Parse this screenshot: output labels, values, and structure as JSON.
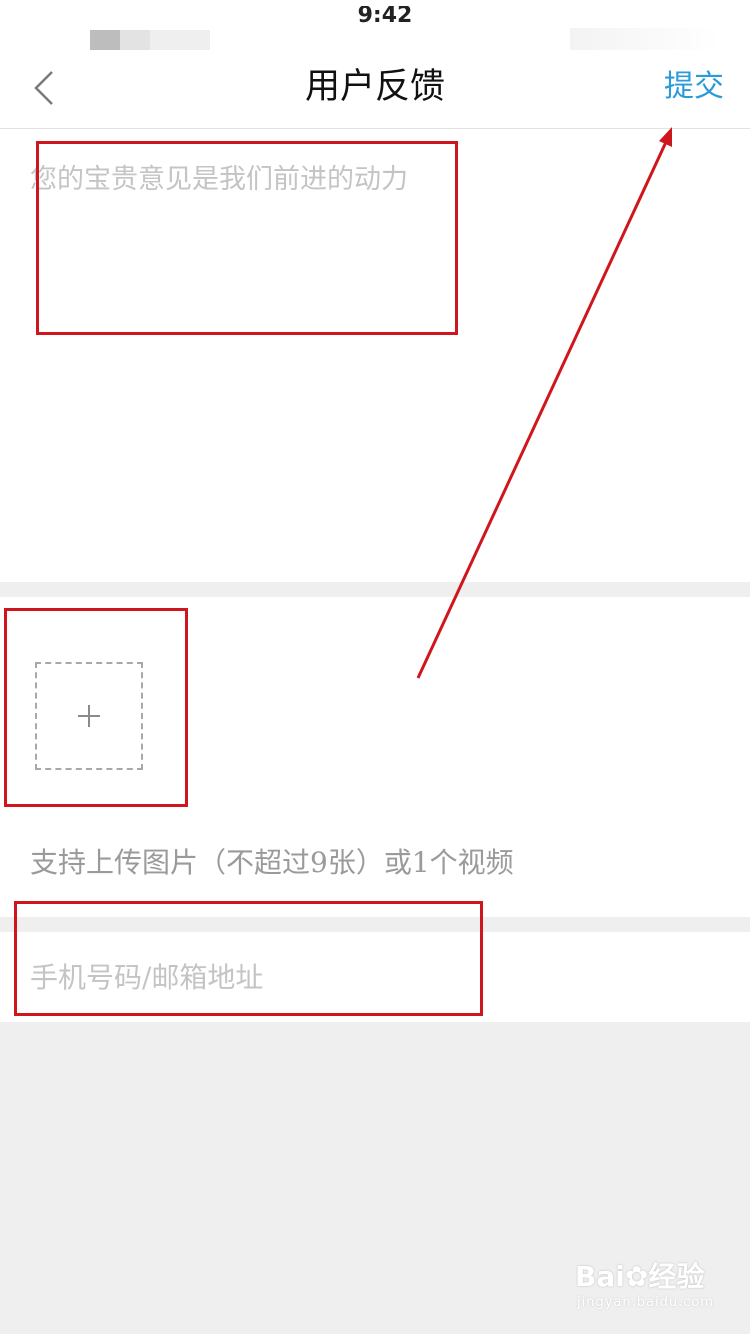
{
  "status_bar": {
    "time": "9:42"
  },
  "nav": {
    "title": "用户反馈",
    "submit_label": "提交"
  },
  "feedback": {
    "placeholder": "您的宝贵意见是我们前进的动力",
    "value": ""
  },
  "upload": {
    "hint": "支持上传图片（不超过9张）或1个视频"
  },
  "contact": {
    "placeholder": "手机号码/邮箱地址",
    "value": ""
  },
  "watermark": {
    "brand": "Bai",
    "brand_cn": "经验",
    "url": "jingyan.baidu.com"
  },
  "icons": {
    "back": "chevron-left-icon",
    "add": "plus-icon",
    "paw": "paw-icon"
  },
  "colors": {
    "accent": "#2a9ad8",
    "annotation": "#d0161d",
    "page_background": "#efefef",
    "placeholder": "#c4c4c4",
    "hint_text": "#9a9a9a"
  }
}
